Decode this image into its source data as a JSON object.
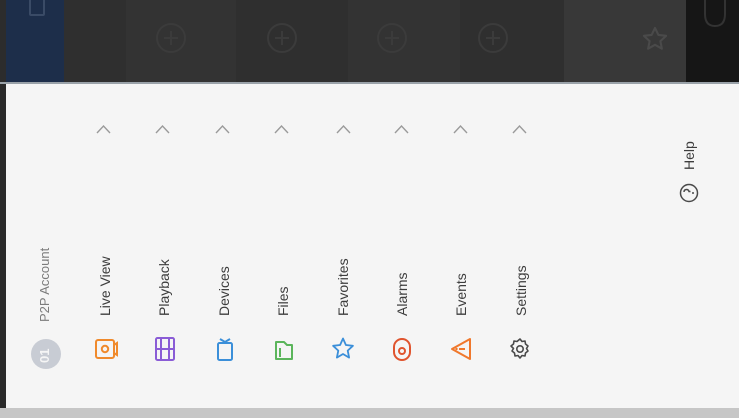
{
  "account": {
    "label": "P2P Account",
    "avatar_initial": "01"
  },
  "nav": {
    "items": [
      {
        "label": "Live View",
        "icon": "camera-icon",
        "color": "#f08a2c"
      },
      {
        "label": "Playback",
        "icon": "film-icon",
        "color": "#8a5cd6"
      },
      {
        "label": "Devices",
        "icon": "device-icon",
        "color": "#3b8fd9"
      },
      {
        "label": "Files",
        "icon": "folder-icon",
        "color": "#5bb55b"
      },
      {
        "label": "Favorites",
        "icon": "star-icon",
        "color": "#3b8fd9"
      },
      {
        "label": "Alarms",
        "icon": "alarm-icon",
        "color": "#e0542e"
      },
      {
        "label": "Events",
        "icon": "warning-icon",
        "color": "#f0782c"
      },
      {
        "label": "Settings",
        "icon": "gear-icon",
        "color": "#4a4a4a"
      }
    ]
  },
  "footer": {
    "help_label": "Help",
    "help_icon": "help-icon"
  },
  "topbar": {
    "add_slot_count": 4,
    "favorite_icon": "star-outline-icon"
  },
  "theme": {
    "topbar_bg": "#2c2c2c",
    "drawer_bg": "#f5f5f5",
    "active_stripe": "#1d2e4a",
    "text": "#3d3d3d",
    "muted_text": "#7b7b7b"
  }
}
